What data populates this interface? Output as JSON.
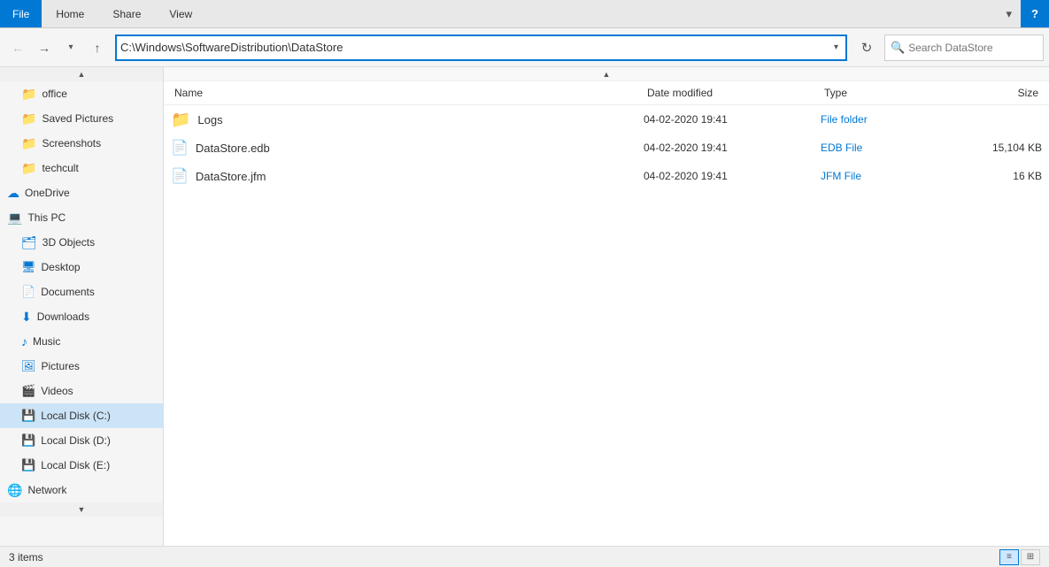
{
  "titlebar": {
    "file_tab": "File",
    "home_tab": "Home",
    "share_tab": "Share",
    "view_tab": "View",
    "help_label": "?"
  },
  "navbar": {
    "back_label": "←",
    "forward_label": "→",
    "up_label": "↑",
    "dropdown_label": "▾",
    "address": "C:\\Windows\\SoftwareDistribution\\DataStore",
    "refresh_label": "↻",
    "search_placeholder": "Search DataStore"
  },
  "sidebar": {
    "scroll_up": "▲",
    "scroll_down": "▼",
    "items": [
      {
        "id": "office",
        "label": "office",
        "icon": "📁",
        "indent": 1
      },
      {
        "id": "saved-pictures",
        "label": "Saved Pictures",
        "icon": "📁",
        "indent": 1
      },
      {
        "id": "screenshots",
        "label": "Screenshots",
        "icon": "📁",
        "indent": 1
      },
      {
        "id": "techcult",
        "label": "techcult",
        "icon": "📁",
        "indent": 1
      },
      {
        "id": "onedrive",
        "label": "OneDrive",
        "icon": "☁",
        "indent": 0
      },
      {
        "id": "thispc",
        "label": "This PC",
        "icon": "💻",
        "indent": 0
      },
      {
        "id": "3dobjects",
        "label": "3D Objects",
        "icon": "🗂",
        "indent": 1
      },
      {
        "id": "desktop",
        "label": "Desktop",
        "icon": "🖥",
        "indent": 1
      },
      {
        "id": "documents",
        "label": "Documents",
        "icon": "📄",
        "indent": 1
      },
      {
        "id": "downloads",
        "label": "Downloads",
        "icon": "⬇",
        "indent": 1
      },
      {
        "id": "music",
        "label": "Music",
        "icon": "♪",
        "indent": 1
      },
      {
        "id": "pictures",
        "label": "Pictures",
        "icon": "🖼",
        "indent": 1
      },
      {
        "id": "videos",
        "label": "Videos",
        "icon": "🎬",
        "indent": 1
      },
      {
        "id": "local-disk-c",
        "label": "Local Disk (C:)",
        "icon": "💿",
        "indent": 1,
        "active": true
      },
      {
        "id": "local-disk-d",
        "label": "Local Disk (D:)",
        "icon": "💿",
        "indent": 1
      },
      {
        "id": "local-disk-e",
        "label": "Local Disk (E:)",
        "icon": "💿",
        "indent": 1
      },
      {
        "id": "network",
        "label": "Network",
        "icon": "🌐",
        "indent": 0
      }
    ]
  },
  "content": {
    "scroll_up": "▲",
    "columns": {
      "name": "Name",
      "date_modified": "Date modified",
      "type": "Type",
      "size": "Size"
    },
    "files": [
      {
        "name": "Logs",
        "date_modified": "04-02-2020 19:41",
        "type": "File folder",
        "size": "",
        "icon": "folder"
      },
      {
        "name": "DataStore.edb",
        "date_modified": "04-02-2020 19:41",
        "type": "EDB File",
        "size": "15,104 KB",
        "icon": "file"
      },
      {
        "name": "DataStore.jfm",
        "date_modified": "04-02-2020 19:41",
        "type": "JFM File",
        "size": "16 KB",
        "icon": "file"
      }
    ]
  },
  "statusbar": {
    "items_count": "3 items",
    "items_label": "Items"
  }
}
